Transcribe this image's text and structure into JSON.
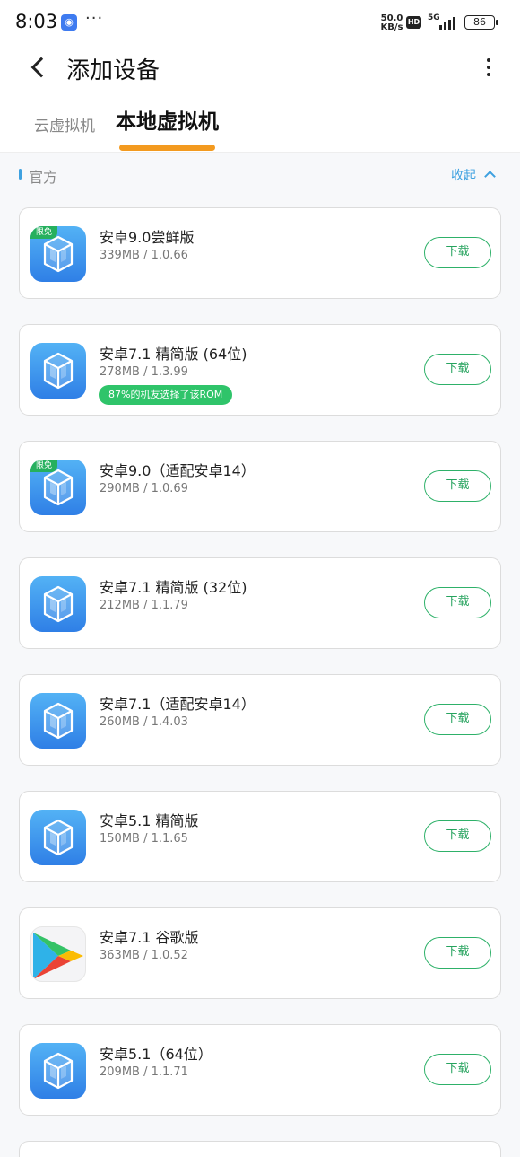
{
  "status_bar": {
    "time": "8:03",
    "more": "···",
    "speed_value": "50.0",
    "speed_unit": "KB/s",
    "hd": "HD",
    "network": "5G",
    "battery": "86"
  },
  "app_bar": {
    "title": "添加设备"
  },
  "tabs": [
    {
      "label": "云虚拟机",
      "active": false
    },
    {
      "label": "本地虚拟机",
      "active": true
    }
  ],
  "colors": {
    "accent_orange": "#f39a1f",
    "link_blue": "#3ea1e0",
    "download_green": "#2eb169",
    "badge_green": "#26b05e",
    "icon_blue": "#3a8eee"
  },
  "section": {
    "label": "官方",
    "collapse_label": "收起"
  },
  "devices": [
    {
      "name": "安卓9.0尝鲜版",
      "meta": "339MB / 1.0.66",
      "badge": "限免",
      "icon": "vm-cube-icon",
      "button": "下载"
    },
    {
      "name": "安卓7.1 精简版 (64位)",
      "meta": "278MB / 1.3.99",
      "pill": "87%的机友选择了该ROM",
      "icon": "vm-cube-icon",
      "button": "下载"
    },
    {
      "name": "安卓9.0（适配安卓14）",
      "meta": "290MB / 1.0.69",
      "badge": "限免",
      "icon": "vm-cube-icon",
      "button": "下载"
    },
    {
      "name": "安卓7.1 精简版 (32位)",
      "meta": "212MB / 1.1.79",
      "icon": "vm-cube-icon",
      "button": "下载"
    },
    {
      "name": "安卓7.1（适配安卓14）",
      "meta": "260MB / 1.4.03",
      "icon": "vm-cube-icon",
      "button": "下载"
    },
    {
      "name": "安卓5.1 精简版",
      "meta": "150MB / 1.1.65",
      "icon": "vm-cube-icon",
      "button": "下载"
    },
    {
      "name": "安卓7.1 谷歌版",
      "meta": "363MB / 1.0.52",
      "icon": "google-play-icon",
      "button": "下载"
    },
    {
      "name": "安卓5.1（64位）",
      "meta": "209MB / 1.1.71",
      "icon": "vm-cube-icon",
      "button": "下载"
    }
  ]
}
